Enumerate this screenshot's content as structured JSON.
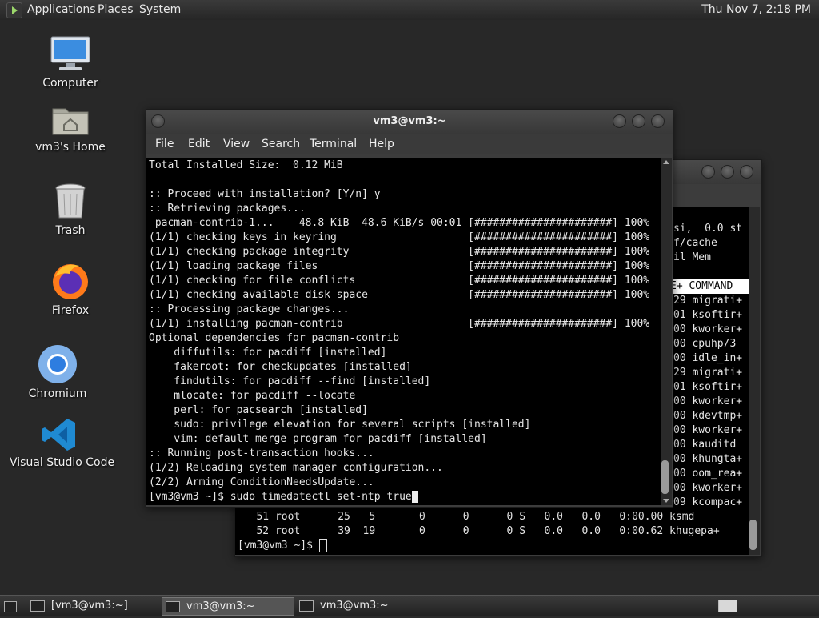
{
  "top_panel": {
    "menus": [
      "Applications",
      "Places",
      "System"
    ],
    "clock": "Thu Nov  7,  2:18 PM"
  },
  "desktop_icons": [
    {
      "label": "Computer",
      "icon": "computer-icon"
    },
    {
      "label": "vm3's Home",
      "icon": "home-folder-icon"
    },
    {
      "label": "Trash",
      "icon": "trash-icon"
    },
    {
      "label": "Firefox",
      "icon": "firefox-icon"
    },
    {
      "label": "Chromium",
      "icon": "chromium-icon"
    },
    {
      "label": "Visual Studio Code",
      "icon": "vscode-icon"
    }
  ],
  "front_window": {
    "title": "vm3@vm3:~",
    "menu": [
      "File",
      "Edit",
      "View",
      "Search",
      "Terminal",
      "Help"
    ],
    "lines": [
      "Total Installed Size:  0.12 MiB",
      "",
      ":: Proceed with installation? [Y/n] y",
      ":: Retrieving packages...",
      " pacman-contrib-1...    48.8 KiB  48.6 KiB/s 00:01 [######################] 100%",
      "(1/1) checking keys in keyring                     [######################] 100%",
      "(1/1) checking package integrity                   [######################] 100%",
      "(1/1) loading package files                        [######################] 100%",
      "(1/1) checking for file conflicts                  [######################] 100%",
      "(1/1) checking available disk space                [######################] 100%",
      ":: Processing package changes...",
      "(1/1) installing pacman-contrib                    [######################] 100%",
      "Optional dependencies for pacman-contrib",
      "    diffutils: for pacdiff [installed]",
      "    fakeroot: for checkupdates [installed]",
      "    findutils: for pacdiff --find [installed]",
      "    mlocate: for pacdiff --locate",
      "    perl: for pacsearch [installed]",
      "    sudo: privilege elevation for several scripts [installed]",
      "    vim: default merge program for pacdiff [installed]",
      ":: Running post-transaction hooks...",
      "(1/2) Reloading system manager configuration...",
      "(2/2) Arming ConditionNeedsUpdate..."
    ],
    "prompt": "[vm3@vm3 ~]$ sudo timedatectl set-ntp true"
  },
  "back_window": {
    "lines_right": [
      "si,  0.0 st",
      "f/cache",
      "il Mem",
      "",
      "E+ COMMAND",
      "29 migrati+",
      "01 ksoftir+",
      "00 kworker+",
      "00 cpuhp/3",
      "00 idle_in+",
      "29 migrati+",
      "01 ksoftir+",
      "00 kworker+",
      "00 kdevtmp+",
      "00 kworker+",
      "00 kauditd",
      "00 khungta+",
      "00 oom_rea+",
      "00 kworker+",
      "09 kcompac+"
    ],
    "bottom_lines": [
      "   51 root      25   5       0      0      0 S   0.0   0.0   0:00.00 ksmd",
      "   52 root      39  19       0      0      0 S   0.0   0.0   0:00.62 khugepa+"
    ],
    "prompt": "[vm3@vm3 ~]$ "
  },
  "taskbar": {
    "items": [
      "[vm3@vm3:~]",
      "vm3@vm3:~",
      "vm3@vm3:~"
    ]
  }
}
